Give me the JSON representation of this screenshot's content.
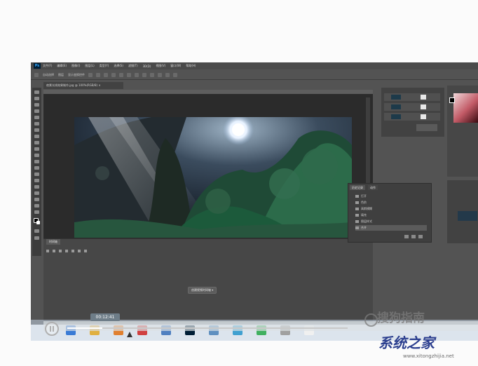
{
  "app": {
    "logo": "Ps",
    "menu": [
      "文件(F)",
      "编辑(E)",
      "图像(I)",
      "图层(L)",
      "类型(Y)",
      "选择(S)",
      "滤镜(T)",
      "3D(D)",
      "视图(V)",
      "窗口(W)",
      "帮助(H)"
    ]
  },
  "options_bar": {
    "items": [
      "自动选择",
      "图层",
      "显示变换控件"
    ]
  },
  "document": {
    "tab": "夜景光线效果制作.jpg @ 100%(RGB/8) ×"
  },
  "timeline": {
    "tab": "时间轴",
    "create_button": "创建视频时间轴"
  },
  "history": {
    "tabs": [
      "历史记录",
      "动作"
    ],
    "items": [
      "打开",
      "色阶",
      "高斯模糊",
      "填充",
      "图层样式",
      "合并"
    ]
  },
  "video": {
    "current_time": "00:12:41",
    "progress": 0.125
  },
  "watermarks": {
    "sogou": "搜狗指南",
    "site": "系统之家",
    "site_url": "www.xitongzhijia.net"
  },
  "colors": {
    "ps_bg": "#535353",
    "menubar": "#4a4a4a",
    "accent": "#31a8ff"
  }
}
